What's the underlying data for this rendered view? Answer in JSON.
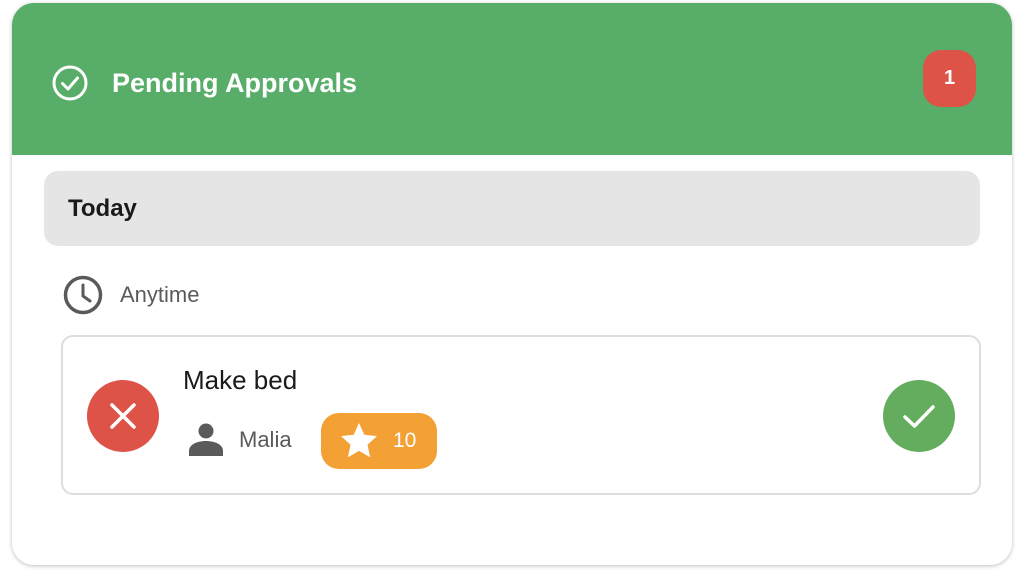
{
  "header": {
    "title": "Pending Approvals",
    "icon": "check-circle-icon",
    "count": "1",
    "background_color": "#58ad69",
    "badge_color": "#de5347"
  },
  "section": {
    "title": "Today"
  },
  "time_group": {
    "icon": "clock-icon",
    "label": "Anytime"
  },
  "chore": {
    "name": "Make bed",
    "assignee": "Malia",
    "assignee_icon": "person-icon",
    "points": "10",
    "points_icon": "star-icon",
    "points_color": "#f3a034",
    "reject_icon": "close-icon",
    "reject_color": "#de5347",
    "approve_icon": "check-icon",
    "approve_color": "#64ad5e"
  }
}
